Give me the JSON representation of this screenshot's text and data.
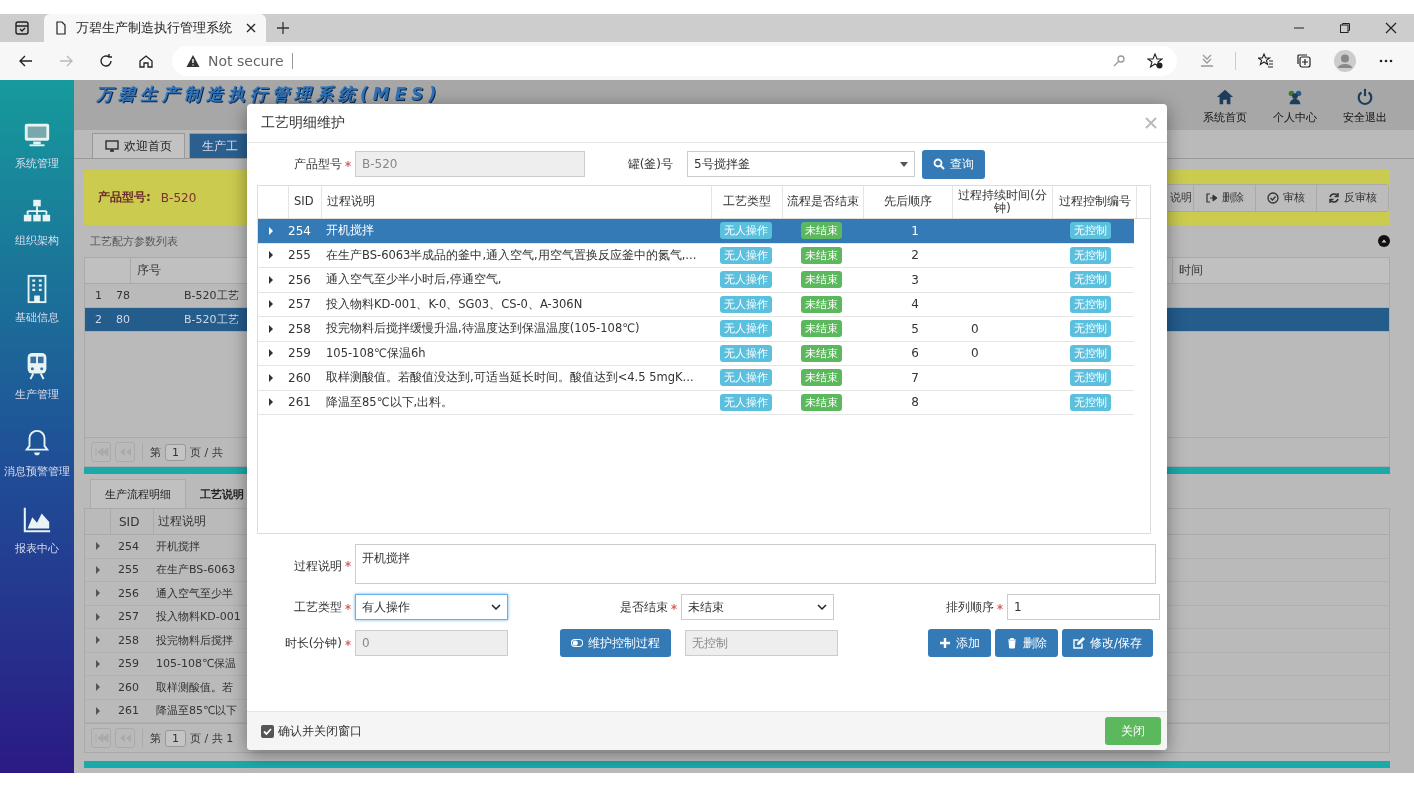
{
  "browser": {
    "tab_title": "万碧生产制造执行管理系统",
    "security": "Not secure"
  },
  "app": {
    "title": "万碧生产制造执行管理系统(MES)",
    "header_links": [
      {
        "label": "系统首页"
      },
      {
        "label": "个人中心"
      },
      {
        "label": "安全退出"
      }
    ]
  },
  "sidebar": {
    "items": [
      {
        "label": "系统管理"
      },
      {
        "label": "组织架构"
      },
      {
        "label": "基础信息"
      },
      {
        "label": "生产管理"
      },
      {
        "label": "消息预警管理"
      },
      {
        "label": "报表中心"
      }
    ]
  },
  "tabs": [
    {
      "label": "欢迎首页",
      "selected": false
    },
    {
      "label": "生产工",
      "selected": true
    }
  ],
  "product_bar": {
    "label": "产品型号:",
    "value": "B-520",
    "buttons": [
      "说明",
      "删除",
      "审核",
      "反审核"
    ]
  },
  "recipe_list": {
    "title": "工艺配方参数列表",
    "columns": [
      "序号",
      "时间"
    ],
    "rows": [
      {
        "index": "1",
        "id": "78",
        "name": "B-520工艺",
        "selected": false
      },
      {
        "index": "2",
        "id": "80",
        "name": "B-520工艺",
        "selected": true
      }
    ],
    "pager": {
      "prefix": "第",
      "page": "1",
      "suffix": "页 / 共"
    }
  },
  "detail_tabs": [
    {
      "label": "生产流程明细",
      "selected": true
    },
    {
      "label": "工艺说明",
      "selected": false
    }
  ],
  "detail_table": {
    "columns": [
      "SID",
      "过程说明"
    ],
    "rows": [
      {
        "sid": "254",
        "desc": "开机搅拌"
      },
      {
        "sid": "255",
        "desc": "在生产BS-6063"
      },
      {
        "sid": "256",
        "desc": "通入空气至少半"
      },
      {
        "sid": "257",
        "desc": "投入物料KD-001"
      },
      {
        "sid": "258",
        "desc": "投完物料后搅拌"
      },
      {
        "sid": "259",
        "desc": "105-108℃保温"
      },
      {
        "sid": "260",
        "desc": "取样测酸值。若"
      },
      {
        "sid": "261",
        "desc": "降温至85℃以下"
      }
    ],
    "pager": {
      "prefix": "第",
      "page": "1",
      "suffix": "页 / 共 1"
    }
  },
  "dialog": {
    "title": "工艺明细维护",
    "product": {
      "label": "产品型号",
      "required": true,
      "value": "B-520"
    },
    "tank": {
      "label": "罐(釜)号",
      "value": "5号搅拌釜"
    },
    "query_button": "查询",
    "table": {
      "columns": [
        "SID",
        "过程说明",
        "工艺类型",
        "流程是否结束",
        "先后顺序",
        "过程持续时间(分钟)",
        "过程控制编号"
      ],
      "rows": [
        {
          "sid": "254",
          "desc": "开机搅拌",
          "type": "无人操作",
          "end": "未结束",
          "order": "1",
          "duration": "",
          "control": "无控制",
          "selected": true
        },
        {
          "sid": "255",
          "desc": "在生产BS-6063半成品的釜中,通入空气,用空气置换反应釜中的氮气,...",
          "type": "无人操作",
          "end": "未结束",
          "order": "2",
          "duration": "",
          "control": "无控制",
          "selected": false
        },
        {
          "sid": "256",
          "desc": "通入空气至少半小时后,停通空气,",
          "type": "无人操作",
          "end": "未结束",
          "order": "3",
          "duration": "",
          "control": "无控制",
          "selected": false
        },
        {
          "sid": "257",
          "desc": "投入物料KD-001、K-0、SG03、CS-0、A-306N",
          "type": "无人操作",
          "end": "未结束",
          "order": "4",
          "duration": "",
          "control": "无控制",
          "selected": false
        },
        {
          "sid": "258",
          "desc": "投完物料后搅拌缓慢升温,待温度达到保温温度(105-108℃)",
          "type": "无人操作",
          "end": "未结束",
          "order": "5",
          "duration": "0",
          "control": "无控制",
          "selected": false
        },
        {
          "sid": "259",
          "desc": "105-108℃保温6h",
          "type": "无人操作",
          "end": "未结束",
          "order": "6",
          "duration": "0",
          "control": "无控制",
          "selected": false
        },
        {
          "sid": "260",
          "desc": "取样测酸值。若酸值没达到,可适当延长时间。酸值达到<4.5 5mgK...",
          "type": "无人操作",
          "end": "未结束",
          "order": "7",
          "duration": "",
          "control": "无控制",
          "selected": false
        },
        {
          "sid": "261",
          "desc": "降温至85℃以下,出料。",
          "type": "无人操作",
          "end": "未结束",
          "order": "8",
          "duration": "",
          "control": "无控制",
          "selected": false
        }
      ]
    },
    "desc_field": {
      "label": "过程说明",
      "required": true,
      "value": "开机搅拌"
    },
    "type_field": {
      "label": "工艺类型",
      "required": true,
      "value": "有人操作"
    },
    "end_field": {
      "label": "是否结束",
      "required": true,
      "value": "未结束"
    },
    "order_field": {
      "label": "排列顺序",
      "required": true,
      "value": "1"
    },
    "duration_field": {
      "label": "时长(分钟)",
      "required": true,
      "value": "0"
    },
    "control_button": "维护控制过程",
    "control_field": {
      "value": "无控制"
    },
    "actions": [
      {
        "label": "添加"
      },
      {
        "label": "删除"
      },
      {
        "label": "修改/保存"
      }
    ],
    "confirm_close": {
      "label": "确认并关闭窗口",
      "checked": true
    },
    "close_button": "关闭"
  }
}
